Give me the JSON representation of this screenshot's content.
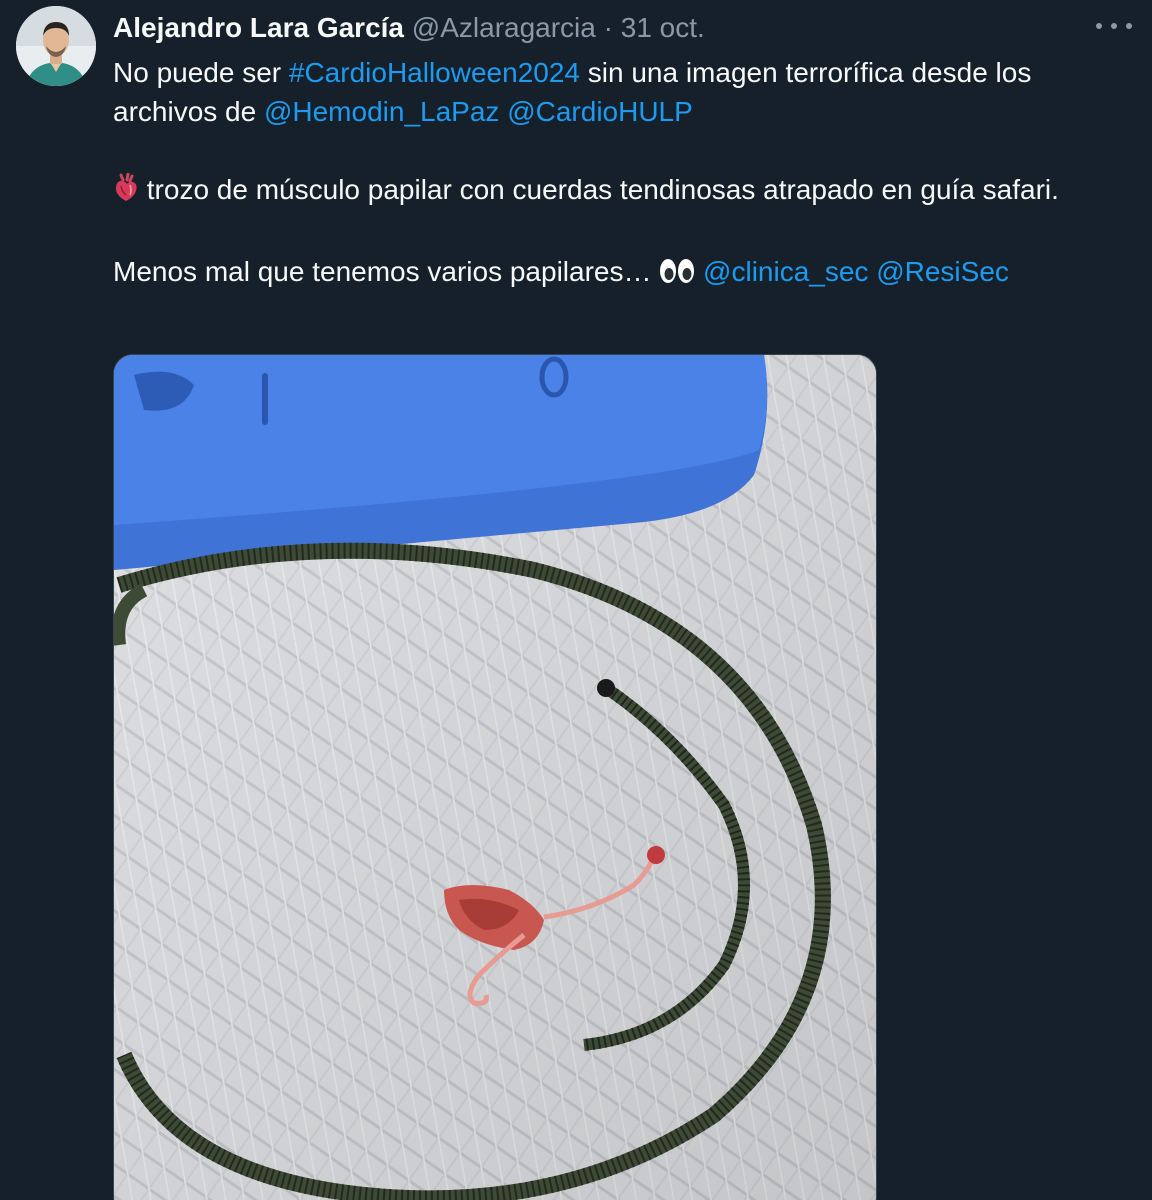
{
  "author": {
    "display_name": "Alejandro Lara García",
    "handle": "@Azlaragarcia",
    "separator": "·",
    "date": "31 oct."
  },
  "tweet": {
    "line1_prefix": "No puede ser ",
    "hashtag": "#CardioHalloween2024",
    "line1_suffix": " sin una imagen terrorífica desde los",
    "line2_prefix": "archivos de ",
    "mention1": "@Hemodin_LaPaz",
    "mention2": "@CardioHULP",
    "para2": " trozo de músculo papilar con cuerdas tendinosas atrapado en guía safari.",
    "para3_text": "Menos mal que tenemos varios papilares… ",
    "mention3": "@clinica_sec",
    "mention4": "@ResiSec"
  },
  "icons": {
    "more": "more-horizontal-icon",
    "heart_emoji": "anatomical-heart-emoji",
    "eyes_emoji": "eyes-emoji"
  },
  "colors": {
    "background": "#15202b",
    "link": "#1d9bf0",
    "muted": "#8b98a5",
    "text": "#f7f9f9"
  }
}
